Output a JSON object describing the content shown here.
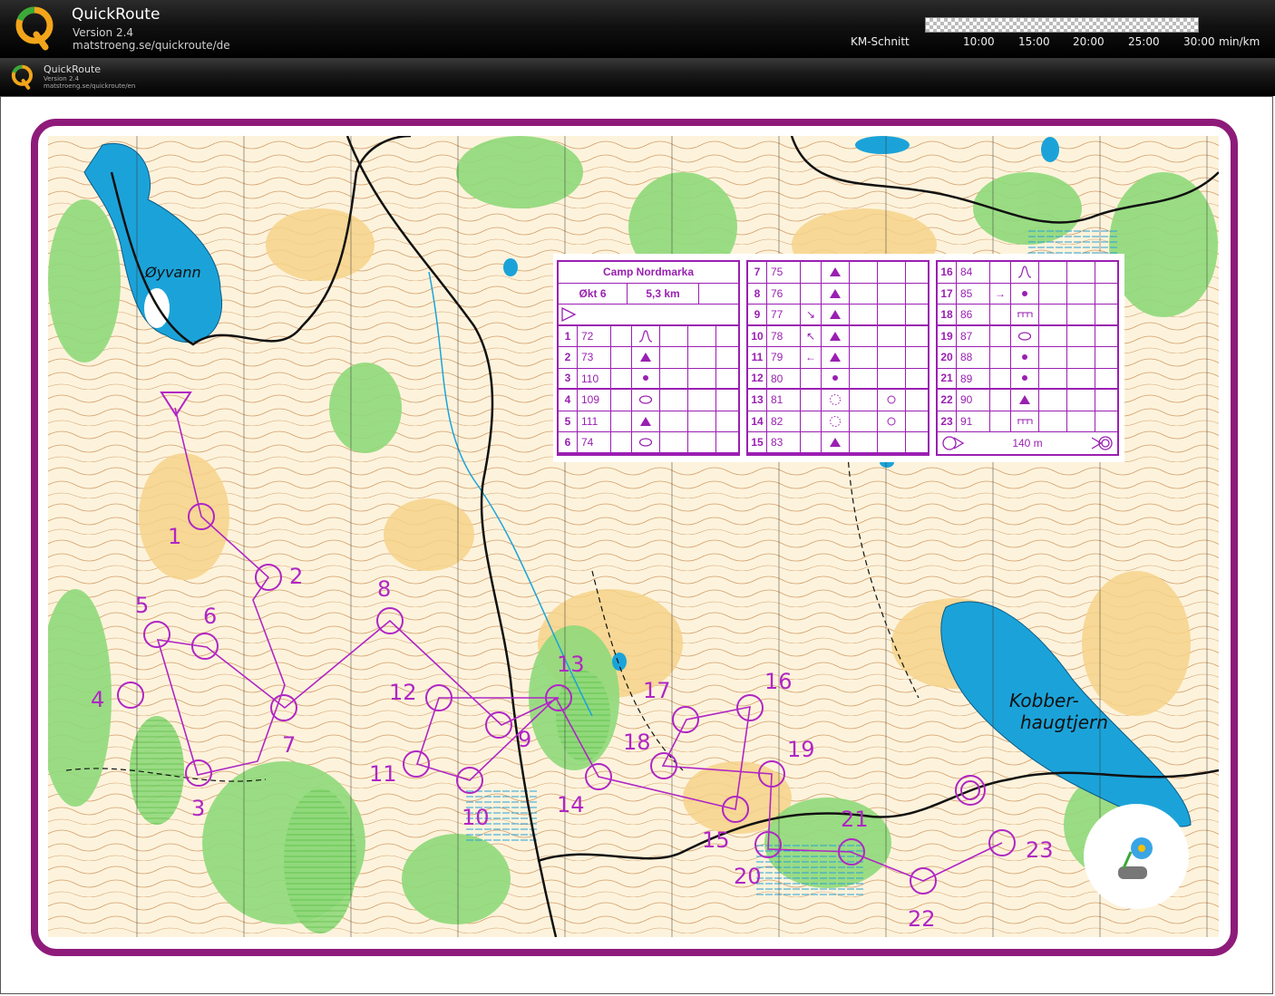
{
  "header": {
    "app_title": "QuickRoute",
    "version": "Version 2.4",
    "url": "matstroeng.se/quickroute/de",
    "pace_label": "KM-Schnitt",
    "pace_ticks": [
      "10:00",
      "15:00",
      "20:00",
      "25:00",
      "30:00"
    ],
    "pace_unit": "min/km"
  },
  "subheader": {
    "app_title": "QuickRoute",
    "version": "Version 2.4",
    "url": "matstroeng.se/quickroute/en"
  },
  "map": {
    "lakes": [
      "Øyvann",
      "Kobber-",
      "haugtjern"
    ],
    "controls": [
      {
        "n": "1"
      },
      {
        "n": "2"
      },
      {
        "n": "3"
      },
      {
        "n": "4"
      },
      {
        "n": "5"
      },
      {
        "n": "6"
      },
      {
        "n": "7"
      },
      {
        "n": "8"
      },
      {
        "n": "9"
      },
      {
        "n": "10"
      },
      {
        "n": "11"
      },
      {
        "n": "12"
      },
      {
        "n": "13"
      },
      {
        "n": "14"
      },
      {
        "n": "15"
      },
      {
        "n": "16"
      },
      {
        "n": "17"
      },
      {
        "n": "18"
      },
      {
        "n": "19"
      },
      {
        "n": "20"
      },
      {
        "n": "21"
      },
      {
        "n": "22"
      },
      {
        "n": "23"
      }
    ]
  },
  "description": {
    "event": "Camp Nordmarka",
    "stage": "Økt 6",
    "length": "5,3 km",
    "finish_distance": "140 m",
    "rows": [
      {
        "n": "1",
        "code": "72",
        "sym": "ravine"
      },
      {
        "n": "2",
        "code": "73",
        "sym": "triangle"
      },
      {
        "n": "3",
        "code": "110",
        "sym": "dot"
      },
      {
        "n": "4",
        "code": "109",
        "sym": "oval"
      },
      {
        "n": "5",
        "code": "111",
        "sym": "triangle"
      },
      {
        "n": "6",
        "code": "74",
        "sym": "oval"
      },
      {
        "n": "7",
        "code": "75",
        "sym": "triangle"
      },
      {
        "n": "8",
        "code": "76",
        "sym": "triangle"
      },
      {
        "n": "9",
        "code": "77",
        "arrow": "↘",
        "sym": "triangle"
      },
      {
        "n": "10",
        "code": "78",
        "arrow": "↖",
        "sym": "triangle"
      },
      {
        "n": "11",
        "code": "79",
        "arrow": "←",
        "sym": "triangle"
      },
      {
        "n": "12",
        "code": "80",
        "sym": "dot"
      },
      {
        "n": "13",
        "code": "81",
        "sym": "dotcircle"
      },
      {
        "n": "14",
        "code": "82",
        "sym": "dotcircle"
      },
      {
        "n": "15",
        "code": "83",
        "sym": "triangle"
      },
      {
        "n": "16",
        "code": "84",
        "sym": "ravine"
      },
      {
        "n": "17",
        "code": "85",
        "arrow": "→",
        "sym": "dot"
      },
      {
        "n": "18",
        "code": "86",
        "sym": "comb"
      },
      {
        "n": "19",
        "code": "87",
        "sym": "oval"
      },
      {
        "n": "20",
        "code": "88",
        "sym": "dot"
      },
      {
        "n": "21",
        "code": "89",
        "sym": "dot"
      },
      {
        "n": "22",
        "code": "90",
        "sym": "triangle"
      },
      {
        "n": "23",
        "code": "91",
        "sym": "comb"
      }
    ]
  },
  "colors": {
    "course": "#b026c4",
    "frame": "#8e1b7a",
    "water": "#1ba3d9",
    "green": "#7fd36b",
    "yellow": "#f7d690",
    "contour": "#b5651d"
  }
}
